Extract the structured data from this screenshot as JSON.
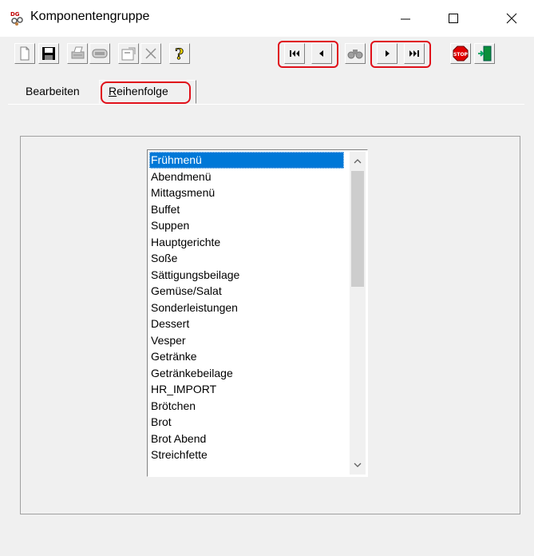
{
  "window": {
    "title": "Komponentengruppe"
  },
  "tabs": [
    {
      "label": "Bearbeiten",
      "active": false
    },
    {
      "label": "Reihenfolge",
      "active": true,
      "accelerator": "R",
      "rest": "eihenfolge"
    }
  ],
  "list": {
    "selected_index": 0,
    "items": [
      "Frühmenü",
      "Abendmenü",
      "Mittagsmenü",
      "Buffet",
      "Suppen",
      "Hauptgerichte",
      "Soße",
      "Sättigungsbeilage",
      "Gemüse/Salat",
      "Sonderleistungen",
      "Dessert",
      "Vesper",
      "Getränke",
      "Getränkebeilage",
      "HR_IMPORT",
      "Brötchen",
      "Brot",
      "Brot Abend",
      "Streichfette"
    ]
  },
  "colors": {
    "selection": "#0078d7",
    "highlight": "#e0101a",
    "dialog": "#f0f0f0"
  }
}
